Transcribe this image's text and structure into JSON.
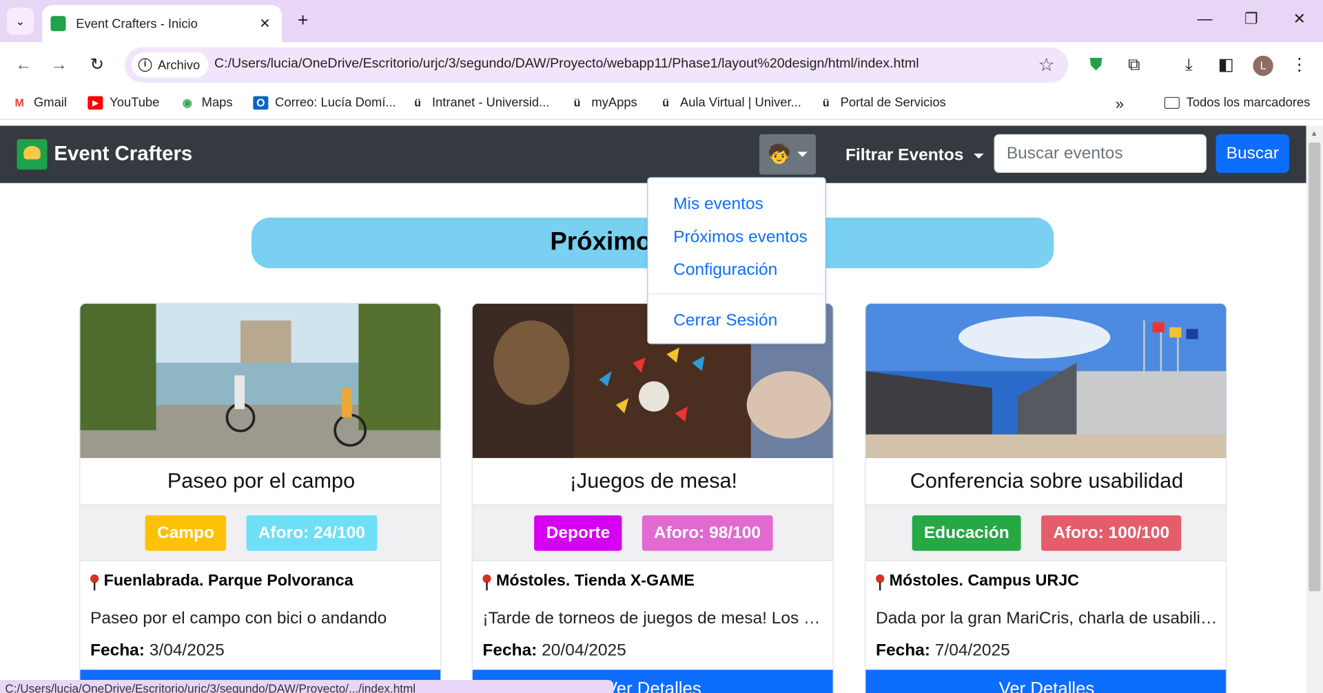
{
  "browser": {
    "tab_title": "Event Crafters - Inicio",
    "chip_label": "Archivo",
    "url": "C:/Users/lucia/OneDrive/Escritorio/urjc/3/segundo/DAW/Proyecto/webapp11/Phase1/layout%20design/html/index.html",
    "profile_initial": "L",
    "status_url": "C:/Users/lucia/OneDrive/Escritorio/urjc/3/segundo/DAW/Proyecto/.../index.html",
    "bookmarks": [
      "Gmail",
      "YouTube",
      "Maps",
      "Correo: Lucía Domí...",
      "Intranet - Universid...",
      "myApps",
      "Aula Virtual | Univer...",
      "Portal de Servicios"
    ],
    "all_bookmarks": "Todos los marcadores"
  },
  "navbar": {
    "brand": "Event Crafters",
    "filter_label": "Filtrar Eventos",
    "search_placeholder": "Buscar eventos",
    "search_button": "Buscar"
  },
  "dropdown": {
    "items": [
      "Mis eventos",
      "Próximos eventos",
      "Configuración"
    ],
    "logout": "Cerrar Sesión"
  },
  "heading": "Próximos eventos",
  "cards": [
    {
      "title": "Paseo por el campo",
      "category": "Campo",
      "category_color": "#ffc107",
      "capacity": "Aforo: 24/100",
      "capacity_color": "#6edff6",
      "location": "Fuenlabrada. Parque Polvoranca",
      "description": "Paseo por el campo con bici o andando",
      "date_label": "Fecha:",
      "date": "3/04/2025",
      "button": "Ver Detalles"
    },
    {
      "title": "¡Juegos de mesa!",
      "category": "Deporte",
      "category_color": "#d600f0",
      "capacity": "Aforo: 98/100",
      "capacity_color": "#e06ad0",
      "location": "Móstoles. Tienda X-GAME",
      "description": "¡Tarde de torneos de juegos de mesa! Los ganadores",
      "date_label": "Fecha:",
      "date": "20/04/2025",
      "button": "Ver Detalles"
    },
    {
      "title": "Conferencia sobre usabilidad",
      "category": "Educación",
      "category_color": "#28a745",
      "capacity": "Aforo: 100/100",
      "capacity_color": "#e35d6a",
      "location": "Móstoles. Campus URJC",
      "description": "Dada por la gran MariCris, charla de usabilidad y",
      "date_label": "Fecha:",
      "date": "7/04/2025",
      "button": "Ver Detalles"
    }
  ]
}
